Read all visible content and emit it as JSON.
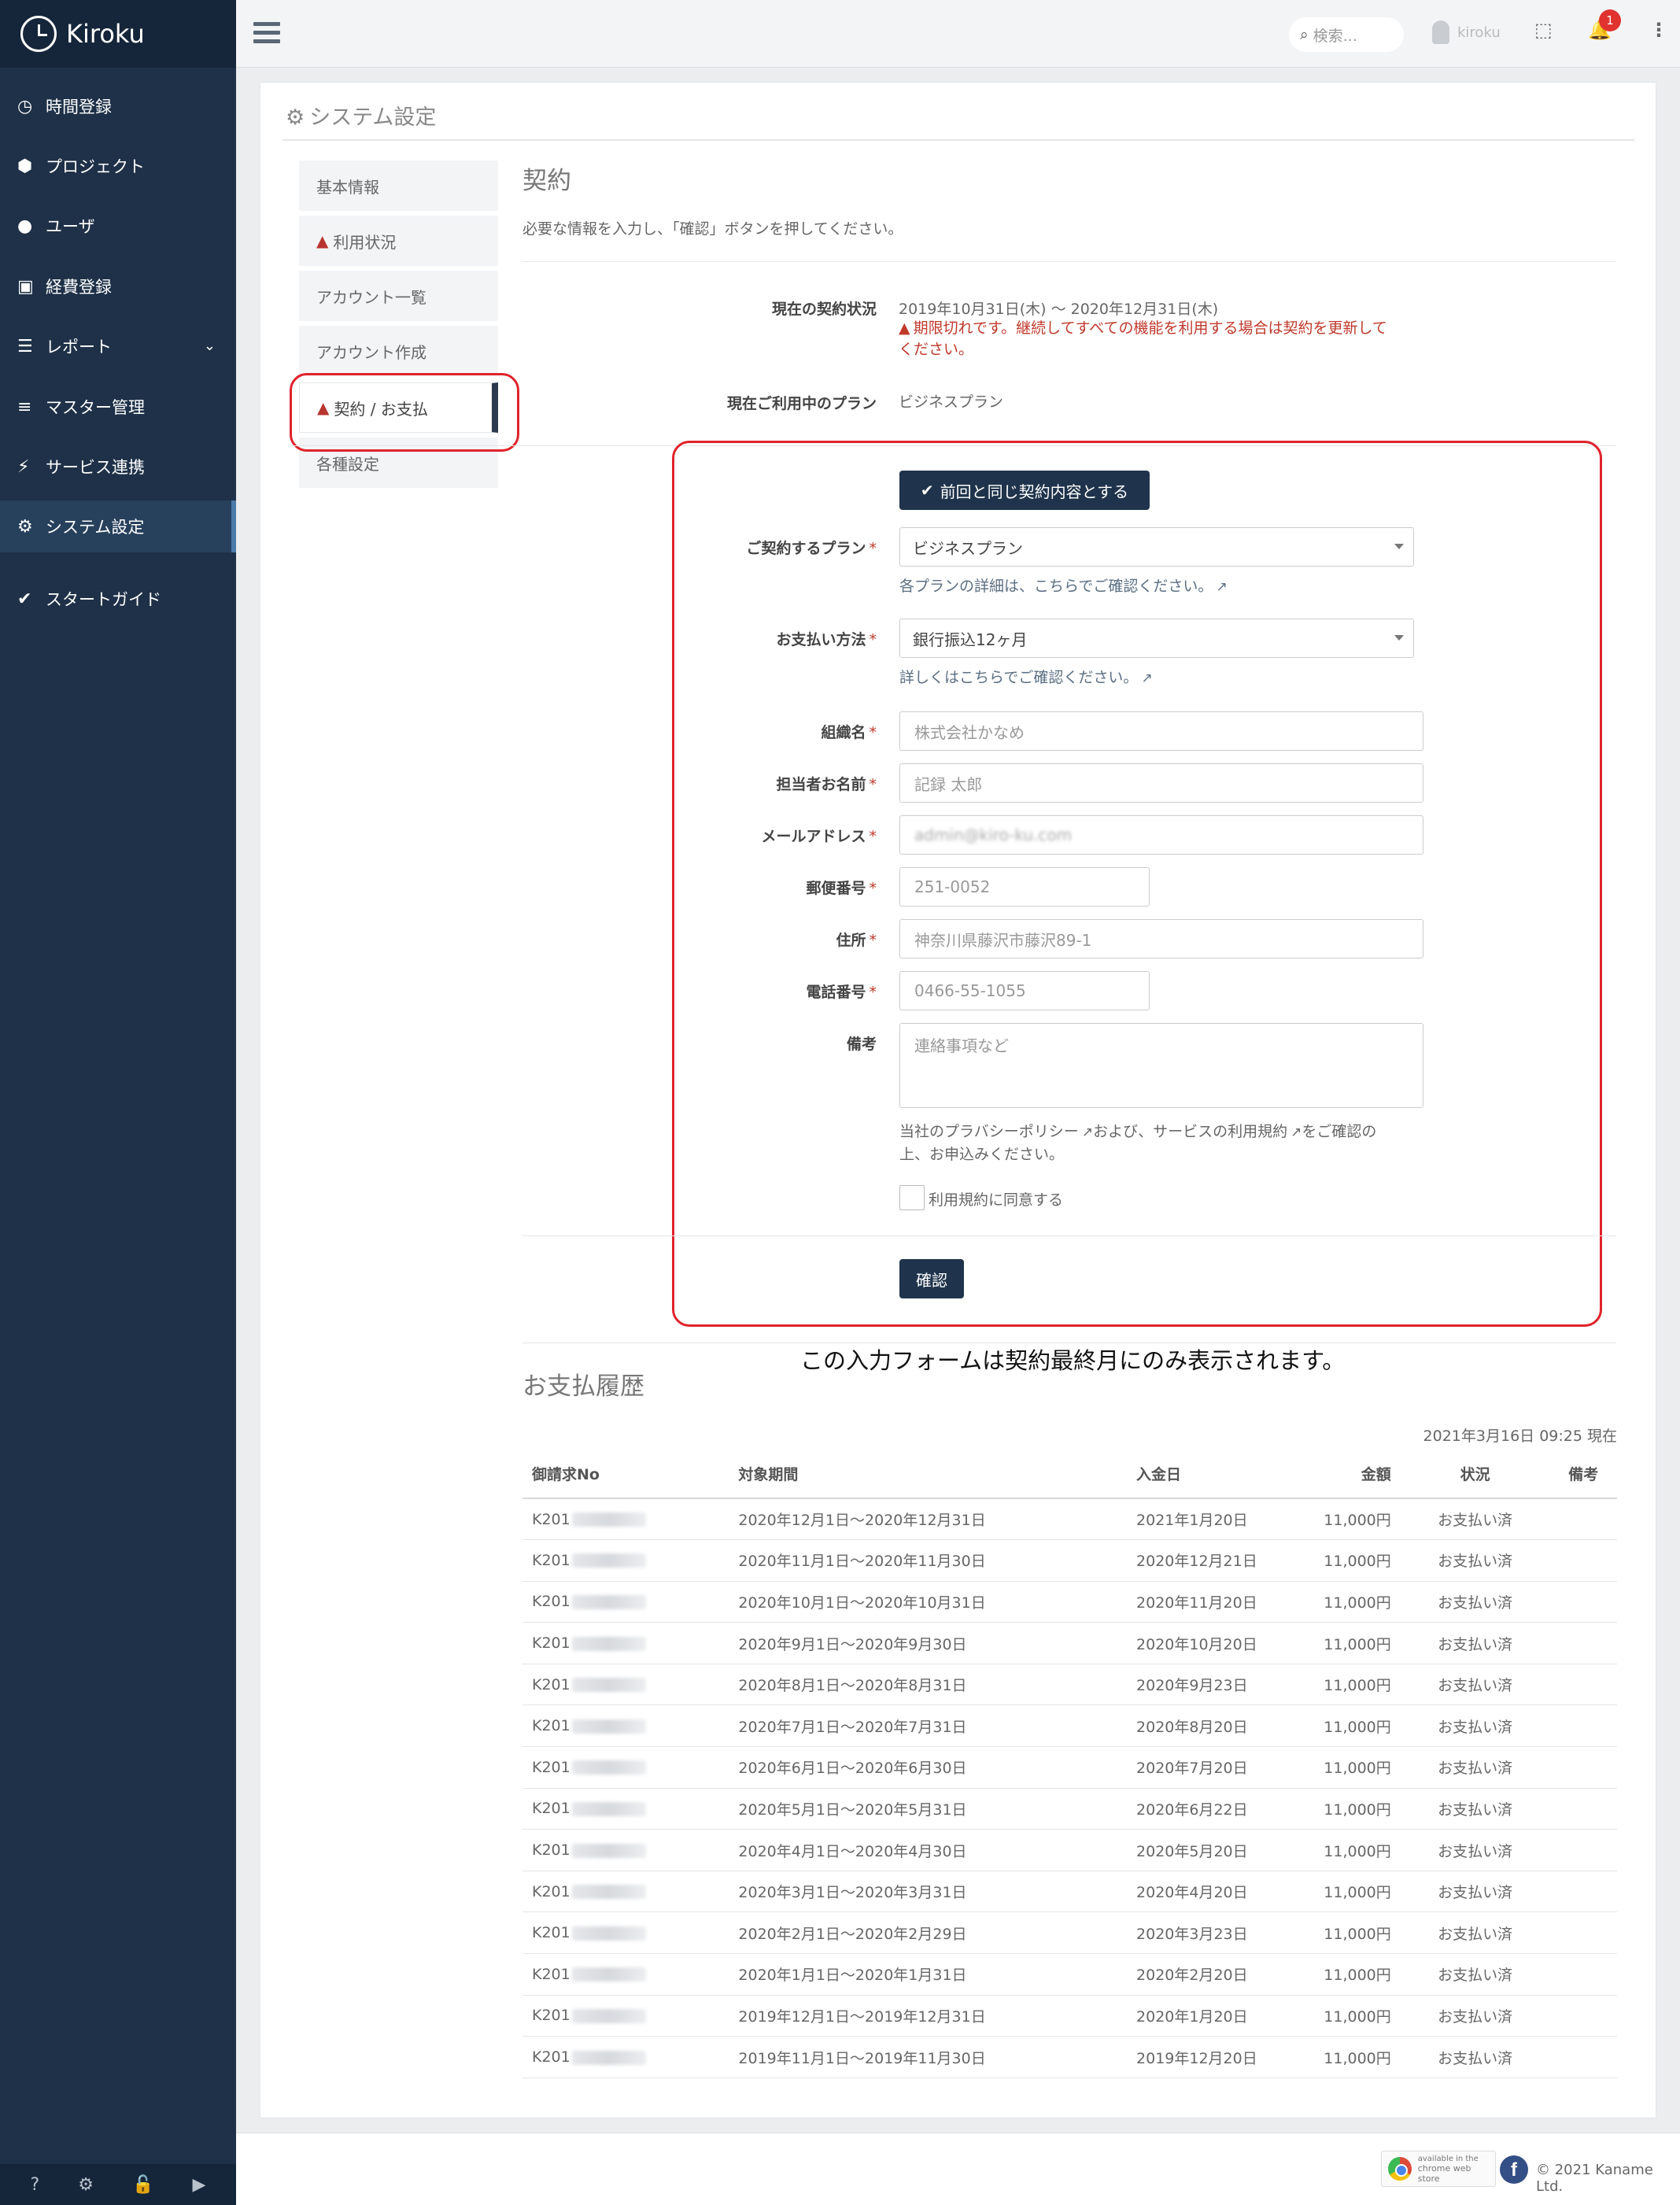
{
  "app": {
    "name": "Kiroku"
  },
  "sidebar": {
    "items": [
      {
        "label": "時間登録",
        "icon": "clock-icon",
        "glyph": "◷"
      },
      {
        "label": "プロジェクト",
        "icon": "cubes-icon",
        "glyph": "⬢"
      },
      {
        "label": "ユーザ",
        "icon": "user-icon",
        "glyph": "●"
      },
      {
        "label": "経費登録",
        "icon": "train-icon",
        "glyph": "▣"
      },
      {
        "label": "レポート",
        "icon": "list-icon",
        "glyph": "☰"
      },
      {
        "label": "マスター管理",
        "icon": "database-icon",
        "glyph": "≡"
      },
      {
        "label": "サービス連携",
        "icon": "plug-icon",
        "glyph": "⚡"
      },
      {
        "label": "システム設定",
        "icon": "gear-icon",
        "glyph": "⚙"
      },
      {
        "label": "スタートガイド",
        "icon": "check-icon",
        "glyph": "✔"
      }
    ],
    "bottom_glyphs": [
      "?",
      "⚙",
      "🔓",
      "▶"
    ]
  },
  "topbar": {
    "search_placeholder": "検索...",
    "user_name": "kiroku",
    "notification_count": "1"
  },
  "page": {
    "title": "システム設定"
  },
  "subnav": [
    {
      "label": "基本情報",
      "warn": false
    },
    {
      "label": "利用状況",
      "warn": true
    },
    {
      "label": "アカウント一覧",
      "warn": false
    },
    {
      "label": "アカウント作成",
      "warn": false
    },
    {
      "label": "契約 / お支払",
      "warn": true
    },
    {
      "label": "各種設定",
      "warn": false
    }
  ],
  "contract": {
    "title": "契約",
    "intro": "必要な情報を入力し、「確認」ボタンを押してください。",
    "status_label": "現在の契約状況",
    "status_value": "2019年10月31日(木) 〜 2020年12月31日(木)",
    "status_warning_line1": "期限切れです。継続してすべての機能を利用する場合は契約を更新して",
    "status_warning_line2": "ください。",
    "plan_label": "現在ご利用中のプラン",
    "plan_value": "ビジネスプラン"
  },
  "form": {
    "same_button": "前回と同じ契約内容とする",
    "plan_label": "ご契約するプラン",
    "plan_value": "ビジネスプラン",
    "plan_help": "各プランの詳細は、こちらでご確認ください。",
    "payment_label": "お支払い方法",
    "payment_value": "銀行振込12ヶ月",
    "payment_help": "詳しくはこちらでご確認ください。",
    "org_label": "組織名",
    "org_value": "株式会社かなめ",
    "person_label": "担当者お名前",
    "person_value": "記録 太郎",
    "email_label": "メールアドレス",
    "email_value": "admin@kiro-ku.com",
    "zip_label": "郵便番号",
    "zip_value": "251-0052",
    "address_label": "住所",
    "address_value": "神奈川県藤沢市藤沢89-1",
    "phone_label": "電話番号",
    "phone_value": "0466-55-1055",
    "memo_label": "備考",
    "memo_placeholder": "連絡事項など",
    "privacy_text1": "当社のプラバシーポリシー",
    "privacy_text2": "および、サービスの利用規約",
    "privacy_text3": "をご確認の",
    "privacy_text4": "上、お申込みください。",
    "agree_label": "利用規約に同意する",
    "confirm_button": "確認",
    "required_mark": "*"
  },
  "annotation": "この入力フォームは契約最終月にのみ表示されます。",
  "history": {
    "title": "お支払履歴",
    "timestamp": "2021年3月16日 09:25 現在",
    "headers": [
      "御請求No",
      "対象期間",
      "入金日",
      "金額",
      "状況",
      "備考"
    ],
    "rows": [
      {
        "no": "K201",
        "period": "2020年12月1日〜2020年12月31日",
        "paid": "2021年1月20日",
        "amount": "11,000円",
        "status": "お支払い済",
        "memo": ""
      },
      {
        "no": "K201",
        "period": "2020年11月1日〜2020年11月30日",
        "paid": "2020年12月21日",
        "amount": "11,000円",
        "status": "お支払い済",
        "memo": ""
      },
      {
        "no": "K201",
        "period": "2020年10月1日〜2020年10月31日",
        "paid": "2020年11月20日",
        "amount": "11,000円",
        "status": "お支払い済",
        "memo": ""
      },
      {
        "no": "K201",
        "period": "2020年9月1日〜2020年9月30日",
        "paid": "2020年10月20日",
        "amount": "11,000円",
        "status": "お支払い済",
        "memo": ""
      },
      {
        "no": "K201",
        "period": "2020年8月1日〜2020年8月31日",
        "paid": "2020年9月23日",
        "amount": "11,000円",
        "status": "お支払い済",
        "memo": ""
      },
      {
        "no": "K201",
        "period": "2020年7月1日〜2020年7月31日",
        "paid": "2020年8月20日",
        "amount": "11,000円",
        "status": "お支払い済",
        "memo": ""
      },
      {
        "no": "K201",
        "period": "2020年6月1日〜2020年6月30日",
        "paid": "2020年7月20日",
        "amount": "11,000円",
        "status": "お支払い済",
        "memo": ""
      },
      {
        "no": "K201",
        "period": "2020年5月1日〜2020年5月31日",
        "paid": "2020年6月22日",
        "amount": "11,000円",
        "status": "お支払い済",
        "memo": ""
      },
      {
        "no": "K201",
        "period": "2020年4月1日〜2020年4月30日",
        "paid": "2020年5月20日",
        "amount": "11,000円",
        "status": "お支払い済",
        "memo": ""
      },
      {
        "no": "K201",
        "period": "2020年3月1日〜2020年3月31日",
        "paid": "2020年4月20日",
        "amount": "11,000円",
        "status": "お支払い済",
        "memo": ""
      },
      {
        "no": "K201",
        "period": "2020年2月1日〜2020年2月29日",
        "paid": "2020年3月23日",
        "amount": "11,000円",
        "status": "お支払い済",
        "memo": ""
      },
      {
        "no": "K201",
        "period": "2020年1月1日〜2020年1月31日",
        "paid": "2020年2月20日",
        "amount": "11,000円",
        "status": "お支払い済",
        "memo": ""
      },
      {
        "no": "K201",
        "period": "2019年12月1日〜2019年12月31日",
        "paid": "2020年1月20日",
        "amount": "11,000円",
        "status": "お支払い済",
        "memo": ""
      },
      {
        "no": "K201",
        "period": "2019年11月1日〜2019年11月30日",
        "paid": "2019年12月20日",
        "amount": "11,000円",
        "status": "お支払い済",
        "memo": ""
      }
    ]
  },
  "footer": {
    "store_line1": "available in the",
    "store_line2": "chrome web store",
    "fb": "f",
    "copyright": "© 2021 Kaname Ltd."
  },
  "colors": {
    "sidebar": "#1e3148",
    "accent_dark": "#1f344c",
    "warning": "#c0392b",
    "highlight": "#e0232b"
  }
}
